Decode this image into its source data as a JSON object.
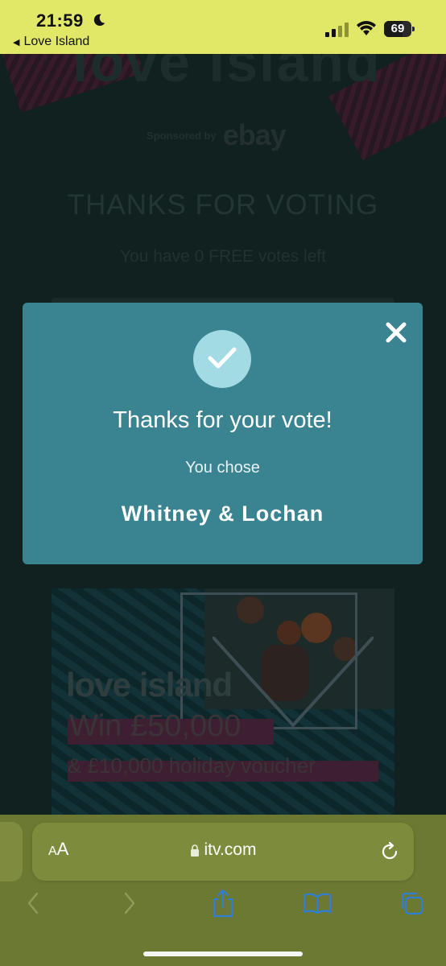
{
  "status_bar": {
    "time": "21:59",
    "back_app_label": "Love Island",
    "battery_level": "69",
    "battery_fraction": 0.69
  },
  "background_page": {
    "brand_title": "love island",
    "sponsor_label": "Sponsored by",
    "sponsor_brand": "ebay",
    "heading": "THANKS FOR VOTING",
    "subheading": "You have 0 FREE votes left",
    "promo": {
      "logo": "love island",
      "prize": "Win £50,000",
      "extra": "& £10,000 holiday voucher"
    }
  },
  "modal": {
    "title": "Thanks for your vote!",
    "chose_label": "You chose",
    "choice": "Whitney & Lochan",
    "accent_color": "#3a8390",
    "check_circle_color": "#a2dbe4"
  },
  "browser": {
    "text_size_label_small": "A",
    "text_size_label_large": "A",
    "url": "itv.com",
    "bar_color": "#6c7933"
  }
}
